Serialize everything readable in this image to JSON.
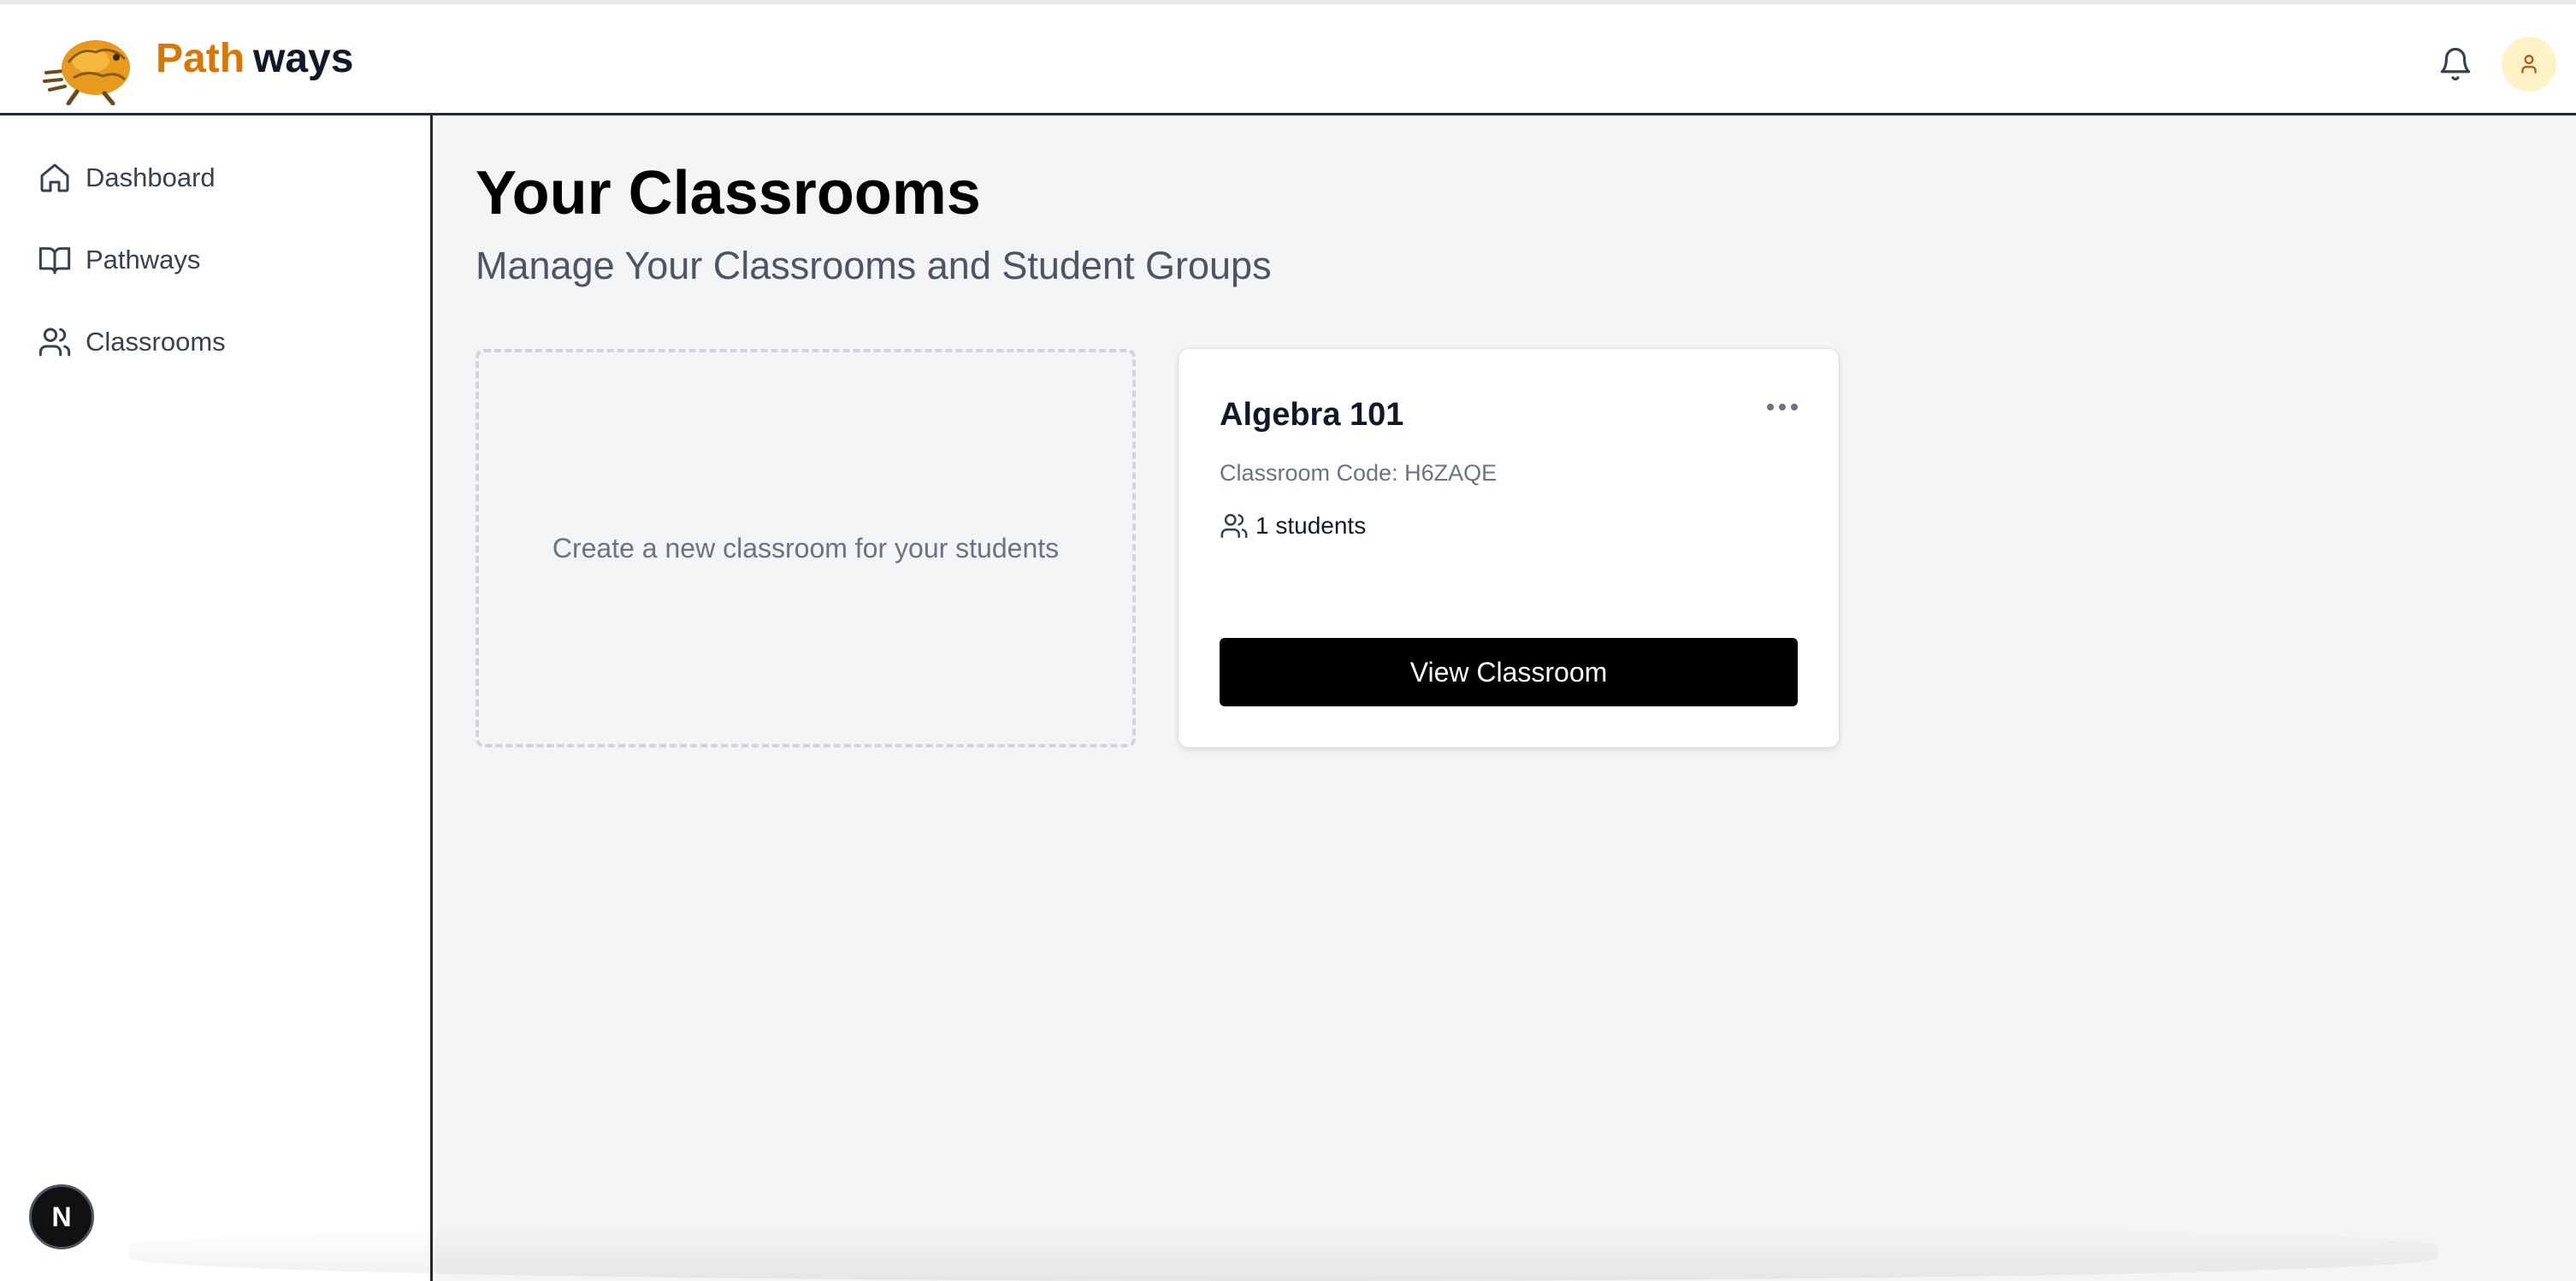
{
  "app": {
    "brand_part1": "Path",
    "brand_part2": "ways",
    "accent_color": "#d97706"
  },
  "header": {
    "icons": [
      "notification-bell-icon",
      "user-icon"
    ]
  },
  "sidebar": {
    "items": [
      {
        "label": "Dashboard",
        "icon": "home-icon"
      },
      {
        "label": "Pathways",
        "icon": "book-open-icon"
      },
      {
        "label": "Classrooms",
        "icon": "users-icon"
      }
    ],
    "badge_letter": "N"
  },
  "main": {
    "title": "Your Classrooms",
    "subtitle": "Manage Your Classrooms and Student Groups",
    "create_card_text": "Create a new classroom for your students",
    "classrooms": [
      {
        "name": "Algebra 101",
        "code_text": "Classroom Code: H6ZAQE",
        "students_text": "1 students",
        "button_label": "View Classroom"
      }
    ]
  }
}
